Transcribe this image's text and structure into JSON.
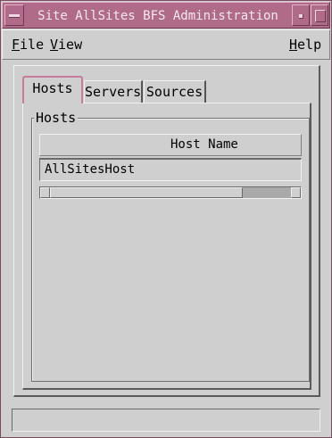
{
  "window": {
    "title": "Site AllSites BFS Administration"
  },
  "menubar": {
    "file": {
      "mnemonic": "F",
      "rest": "ile"
    },
    "view": {
      "mnemonic": "V",
      "rest": "iew"
    },
    "help": {
      "mnemonic": "H",
      "rest": "elp"
    }
  },
  "tabs": [
    {
      "label": "Hosts",
      "selected": true
    },
    {
      "label": "Servers",
      "selected": false
    },
    {
      "label": "Sources",
      "selected": false
    }
  ],
  "hosts_panel": {
    "group_label": "Hosts",
    "columns": [
      "Host Name"
    ],
    "rows": [
      {
        "host_name": "AllSitesHost"
      }
    ]
  },
  "status_bar": {
    "text": ""
  },
  "colors": {
    "title_bar": "#b06a8a",
    "title_text": "#f6e9ef",
    "background": "#cfcfcf",
    "active_tab_border": "#c77c9c"
  },
  "icons": {
    "window_menu": "window-menu-icon",
    "minimize": "minimize-icon",
    "maximize": "maximize-icon",
    "scroll_left": "scroll-left-arrow-icon",
    "scroll_right": "scroll-right-arrow-icon"
  }
}
